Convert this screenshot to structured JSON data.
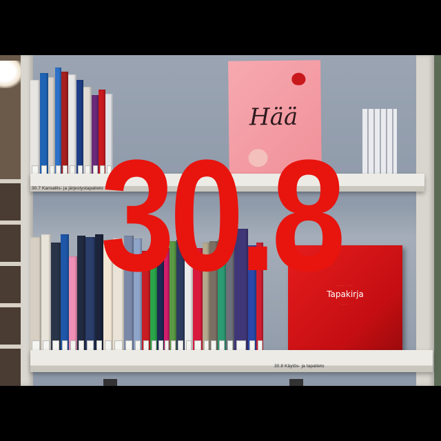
{
  "overlay": {
    "text": "30.8",
    "color": "#e8140e"
  },
  "shelf_labels": {
    "top": "30.7 Kansallis- ja järjestystapatieto",
    "bottom": "30.8 Käytös- ja tapatieto"
  },
  "poster": {
    "title": "Hää"
  },
  "red_book": {
    "title": "Tapakirja",
    "author": "····· ·····",
    "subtitle": "·····"
  },
  "colors": {
    "shelf": "#ecebe6",
    "wall": "#8f9aaa",
    "red_book": "#e61c1c"
  }
}
